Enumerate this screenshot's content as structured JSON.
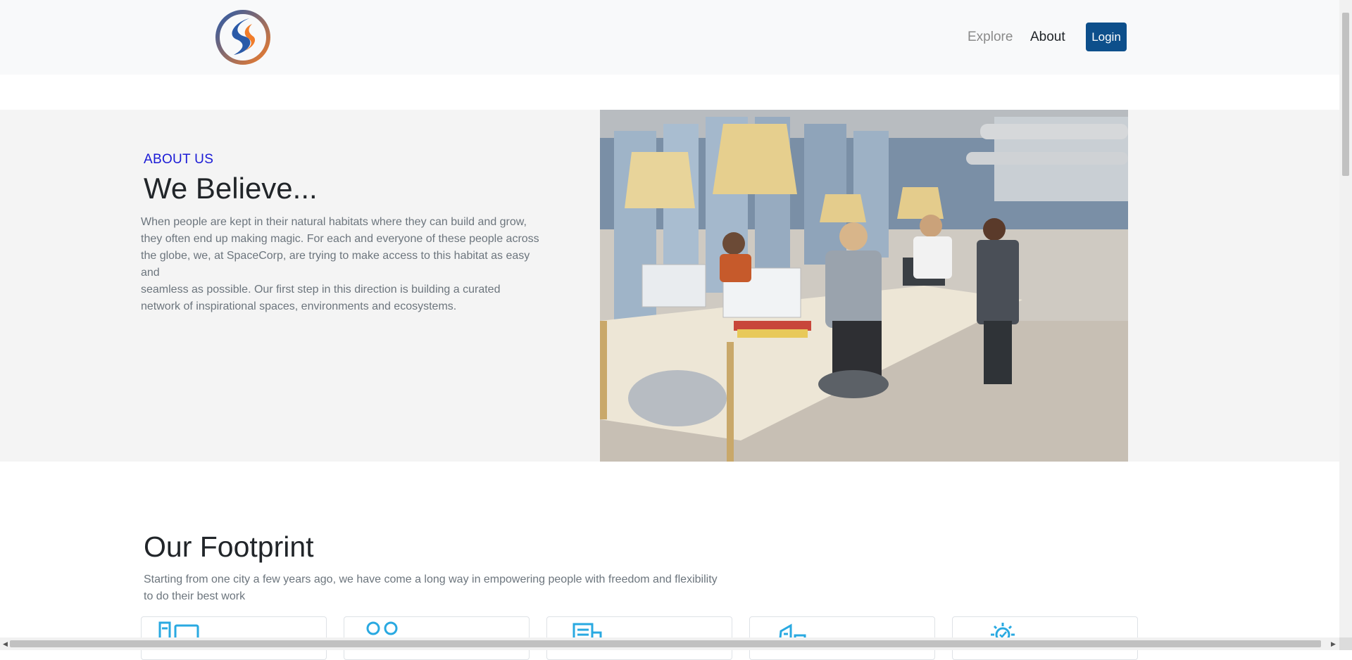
{
  "nav": {
    "explore_label": "Explore",
    "about_label": "About",
    "login_label": "Login"
  },
  "about": {
    "kicker": "ABOUT US",
    "title": "We Believe...",
    "paragraph_lines": [
      "When people are kept in their natural habitats where they can build and grow,",
      "they often end up making magic. For each and everyone of these people across",
      "the globe, we, at SpaceCorp, are trying to make access to this habitat as easy and",
      "seamless as possible. Our first step in this direction is building a curated",
      "network of inspirational spaces, environments and ecosystems."
    ]
  },
  "footprint": {
    "title": "Our Footprint",
    "text_lines": [
      "Starting from one city a few years ago, we have come a long way in empowering people with freedom and flexibility",
      "to do their best work"
    ],
    "cards": [
      {
        "icon": "desk-monitor-icon"
      },
      {
        "icon": "people-icon"
      },
      {
        "icon": "building-icon"
      },
      {
        "icon": "city-icon"
      },
      {
        "icon": "idea-bulb-icon"
      }
    ]
  },
  "colors": {
    "accent_blue": "#0d4f8b",
    "kicker_blue": "#1a1ad6",
    "icon_cyan": "#29a9e1",
    "logo_orange": "#f07c2a",
    "logo_blue": "#2a5aa8"
  }
}
